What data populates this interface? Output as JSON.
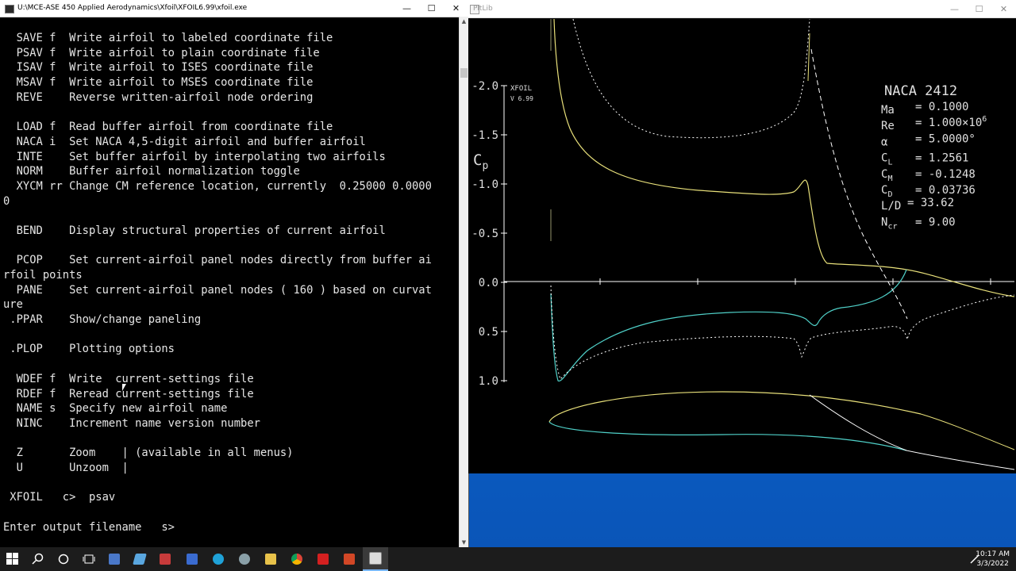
{
  "console": {
    "title": "U:\\MCE-ASE 450 Applied Aerodynamics\\Xfoil\\XFOIL6.99\\xfoil.exe",
    "lines": [
      "  SAVE f  Write airfoil to labeled coordinate file",
      "  PSAV f  Write airfoil to plain coordinate file",
      "  ISAV f  Write airfoil to ISES coordinate file",
      "  MSAV f  Write airfoil to MSES coordinate file",
      "  REVE    Reverse written-airfoil node ordering",
      "",
      "  LOAD f  Read buffer airfoil from coordinate file",
      "  NACA i  Set NACA 4,5-digit airfoil and buffer airfoil",
      "  INTE    Set buffer airfoil by interpolating two airfoils",
      "  NORM    Buffer airfoil normalization toggle",
      "  XYCM rr Change CM reference location, currently  0.25000 0.0000",
      "0",
      "",
      "  BEND    Display structural properties of current airfoil",
      "",
      "  PCOP    Set current-airfoil panel nodes directly from buffer ai",
      "rfoil points",
      "  PANE    Set current-airfoil panel nodes ( 160 ) based on curvat",
      "ure",
      " .PPAR    Show/change paneling",
      "",
      " .PLOP    Plotting options",
      "",
      "  WDEF f  Write  current-settings file",
      "  RDEF f  Reread current-settings file",
      "  NAME s  Specify new airfoil name",
      "  NINC    Increment name version number",
      "",
      "  Z       Zoom    | (available in all menus)",
      "  U       Unzoom  |",
      "",
      " XFOIL   c>  psav",
      "",
      "Enter output filename   s>"
    ]
  },
  "plot": {
    "window_title": "PltLib",
    "badge_line1": "XFOIL",
    "badge_line2": "V 6.99",
    "cp_label": "C",
    "cp_sub": "p",
    "y_ticks": [
      "-2.0",
      "-1.5",
      "-1.0",
      "-0.5",
      "0.0",
      "0.5",
      "1.0"
    ],
    "airfoil_name": "NACA 2412",
    "stats": [
      {
        "label": "Ma",
        "sub": "",
        "value": "= 0.1000",
        "sup": ""
      },
      {
        "label": "Re",
        "sub": "",
        "value": "= 1.000×10",
        "sup": "6"
      },
      {
        "label": "α",
        "sub": "",
        "value": "= 5.0000°",
        "sup": ""
      },
      {
        "label": "C",
        "sub": "L",
        "value": "= 1.2561",
        "sup": ""
      },
      {
        "label": "C",
        "sub": "M",
        "value": "= -0.1248",
        "sup": ""
      },
      {
        "label": "C",
        "sub": "D",
        "value": "= 0.03736",
        "sup": ""
      },
      {
        "label": "L/D",
        "sub": "",
        "value": "= 33.62",
        "sup": ""
      },
      {
        "label": "N",
        "sub": "cr",
        "value": "= 9.00",
        "sup": ""
      }
    ],
    "colors": {
      "upper": "#e8e07a",
      "lower": "#4fd0c8",
      "inviscid": "#ffffff"
    }
  },
  "taskbar": {
    "time": "10:17 AM",
    "date": "3/3/2022"
  }
}
